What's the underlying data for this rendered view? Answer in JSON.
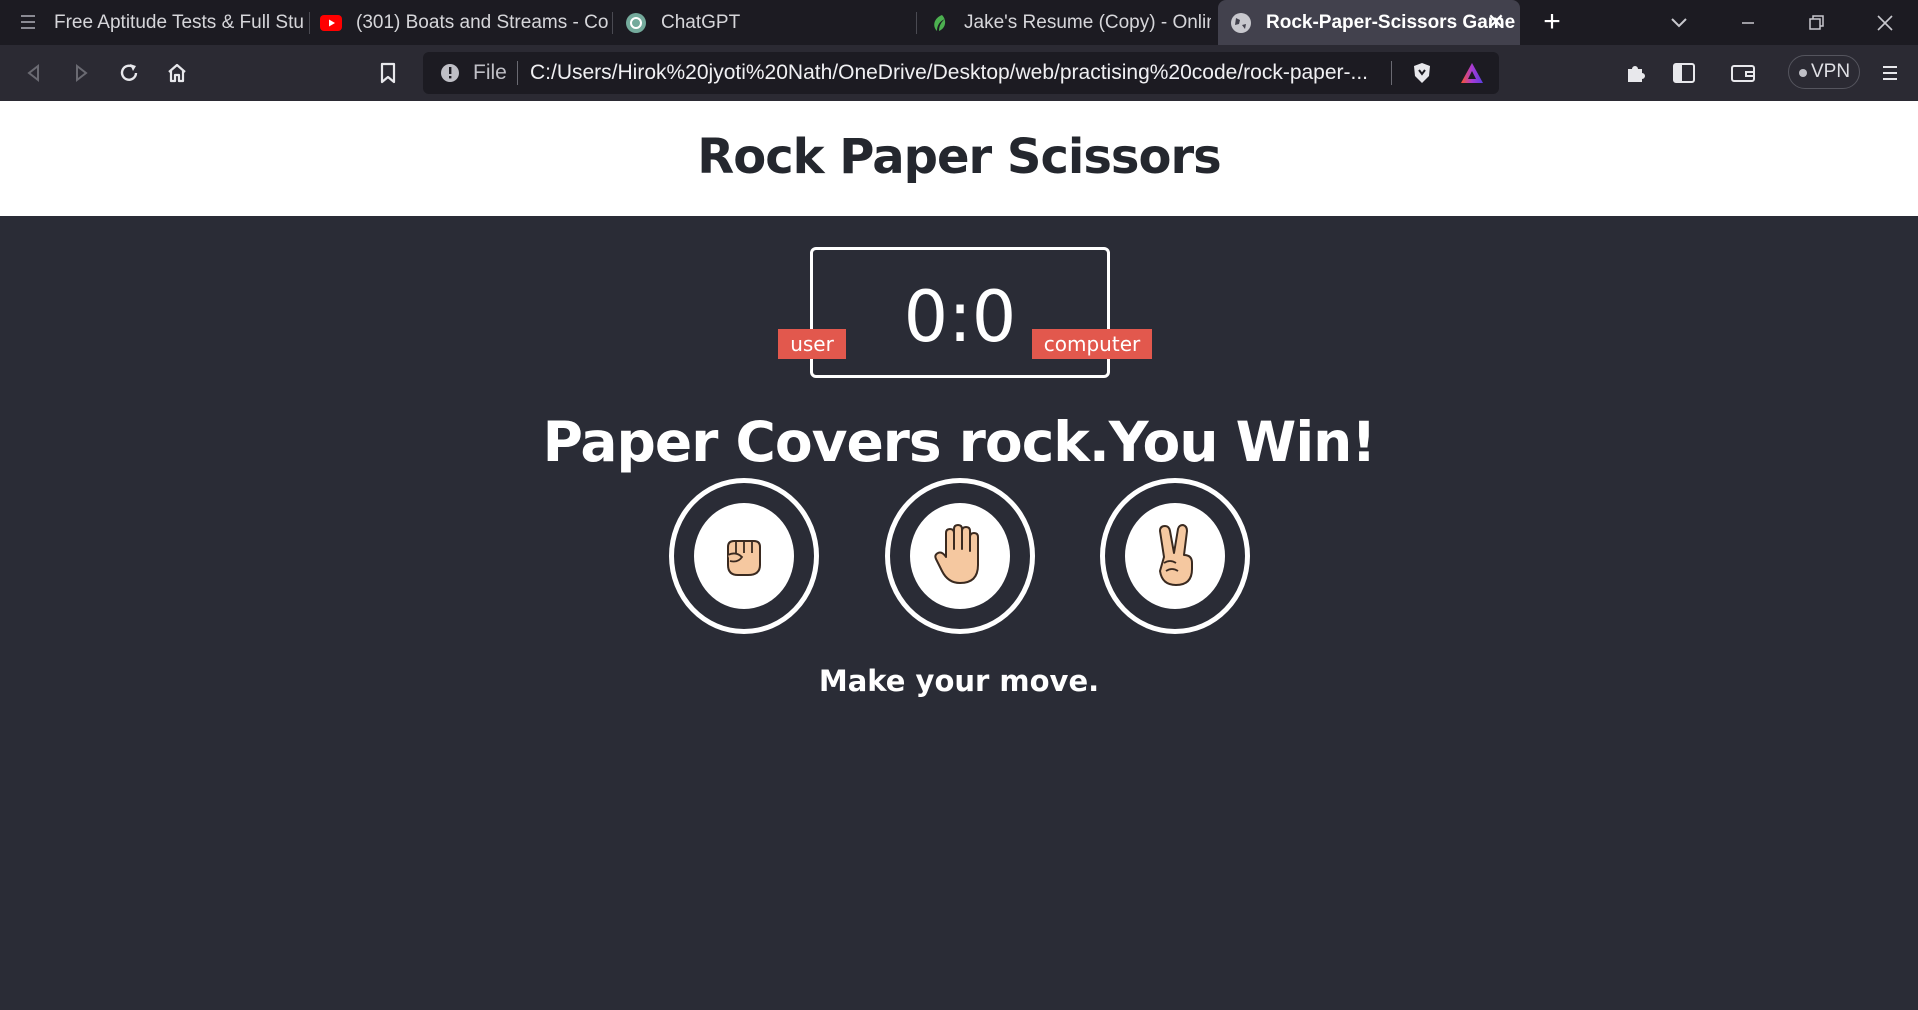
{
  "browser": {
    "tabs": [
      {
        "label": "Free Aptitude Tests & Full Study",
        "icon": "menu-favicon-icon"
      },
      {
        "label": "(301) Boats and Streams - Conc",
        "icon": "youtube-icon"
      },
      {
        "label": "ChatGPT",
        "icon": "chatgpt-icon"
      },
      {
        "label": "Jake's Resume (Copy) - Online",
        "icon": "overleaf-icon"
      },
      {
        "label": "Rock-Paper-Scissors Game",
        "icon": "globe-icon",
        "active": true
      }
    ],
    "new_tab_label": "+",
    "address": {
      "scheme_label": "File",
      "url": "C:/Users/Hirok%20jyoti%20Nath/OneDrive/Desktop/web/practising%20code/rock-paper-..."
    },
    "vpn_label": "VPN"
  },
  "page": {
    "title": "Rock Paper Scissors",
    "score": "0:0",
    "user_label": "user",
    "computer_label": "computer",
    "result": "Paper Covers rock.You Win!",
    "choices": [
      {
        "name": "rock",
        "icon": "fist-icon"
      },
      {
        "name": "paper",
        "icon": "open-hand-icon"
      },
      {
        "name": "scissors",
        "icon": "victory-hand-icon"
      }
    ],
    "prompt": "Make your move."
  },
  "colors": {
    "badge": "#e2584d",
    "game_bg": "#2a2c36",
    "header_bg": "#ffffff",
    "tabstrip_bg": "#1c1b22",
    "active_tab_bg": "#42414d"
  }
}
